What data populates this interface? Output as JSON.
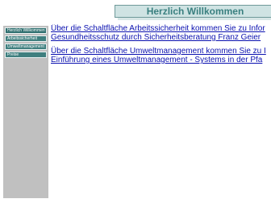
{
  "header": {
    "title": "Herzlich Willkommen"
  },
  "sidebar": {
    "items": [
      {
        "label": "Herzlich Willkommen"
      },
      {
        "label": "Arbeitssicherheit"
      },
      {
        "label": "Umweltmanagement"
      },
      {
        "label": "Preise"
      }
    ]
  },
  "main": {
    "paragraphs": [
      {
        "line1": "Über die Schaltfläche Arbeitssicherheit kommen Sie zu Infor",
        "line2": "Gesundheitsschutz durch Sicherheitsberatung Franz Geier"
      },
      {
        "line1": "Über die Schaltfläche Umweltmanagement kommen Sie zu I",
        "line2": "Einführung eines Umweltmanagement - Systems in der Pfa"
      }
    ]
  },
  "colors": {
    "header_text": "#3a8080",
    "nav_background": "#3f7f7f",
    "sidebar_background": "#c0c0c0",
    "link_text": "#0b11b0"
  }
}
